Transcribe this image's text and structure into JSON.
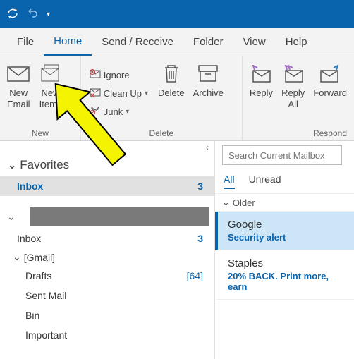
{
  "menubar": {
    "items": [
      "File",
      "Home",
      "Send / Receive",
      "Folder",
      "View",
      "Help"
    ],
    "active_index": 1
  },
  "ribbon": {
    "new_group": {
      "label": "New",
      "new_email": "New\nEmail",
      "new_items": "New\nItems"
    },
    "delete_group": {
      "label": "Delete",
      "ignore": "Ignore",
      "clean_up": "Clean Up",
      "junk": "Junk",
      "delete": "Delete",
      "archive": "Archive"
    },
    "respond_group": {
      "label": "Respond",
      "reply": "Reply",
      "reply_all": "Reply\nAll",
      "forward": "Forward"
    }
  },
  "nav": {
    "favorites_label": "Favorites",
    "inbox": {
      "name": "Inbox",
      "count": "3"
    },
    "account_inbox": {
      "name": "Inbox",
      "count": "3"
    },
    "gmail_label": "[Gmail]",
    "drafts": {
      "name": "Drafts",
      "count": "[64]"
    },
    "sent": {
      "name": "Sent Mail"
    },
    "bin": {
      "name": "Bin"
    },
    "important": {
      "name": "Important"
    }
  },
  "search": {
    "placeholder": "Search Current Mailbox"
  },
  "filters": {
    "all": "All",
    "unread": "Unread",
    "active_index": 0
  },
  "msglist": {
    "group": "Older",
    "messages": [
      {
        "sender": "Google",
        "preview": "Security alert"
      },
      {
        "sender": "Staples",
        "preview": "20% BACK. Print more, earn"
      }
    ]
  }
}
